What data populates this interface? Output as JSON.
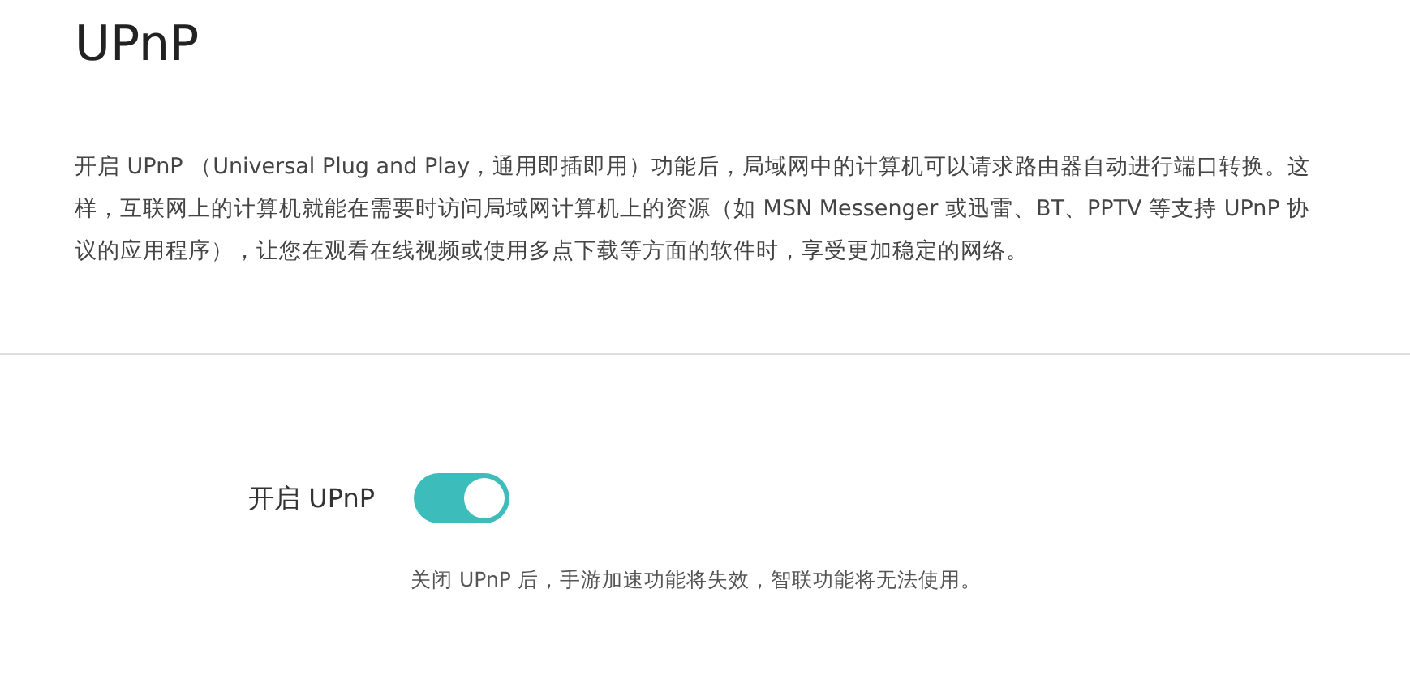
{
  "title": "UPnP",
  "description": "开启 UPnP （Universal Plug and Play，通用即插即用）功能后，局域网中的计算机可以请求路由器自动进行端口转换。这样，互联网上的计算机就能在需要时访问局域网计算机上的资源（如 MSN Messenger 或迅雷、BT、PPTV 等支持 UPnP 协议的应用程序），让您在观看在线视频或使用多点下载等方面的软件时，享受更加稳定的网络。",
  "setting": {
    "label": "开启 UPnP",
    "on": true
  },
  "hint": "关闭 UPnP 后，手游加速功能将失效，智联功能将无法使用。"
}
